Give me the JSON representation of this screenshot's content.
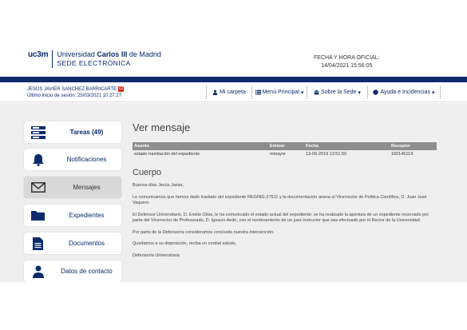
{
  "header": {
    "logo_mark": "uc3m",
    "university_pre": "Universidad ",
    "university_bold": "Carlos III",
    "university_post": " de Madrid",
    "sede": "SEDE ELECTRÓNICA",
    "official_label": "FECHA Y HORA OFICIAL:",
    "official_datetime": "14/04/2021  15:56:05"
  },
  "user": {
    "name": "JESUS JAVIER SANCHEZ BARRICARTE",
    "last_login": "Último inicio de sesión: 25/03/2021 10:27:27",
    "logout_icon": "logout-icon"
  },
  "nav": [
    {
      "label": "Mi carpeta",
      "icon": "person-icon",
      "caret": ""
    },
    {
      "label": "Menú Principal",
      "icon": "list-icon",
      "caret": "▾"
    },
    {
      "label": "Sobre la Sede",
      "icon": "building-icon",
      "caret": "▾"
    },
    {
      "label": "Ayuda e Incidencias",
      "icon": "help-icon",
      "caret": "▾"
    }
  ],
  "sidebar": [
    {
      "label": "Tareas (49)",
      "icon": "tasks-icon",
      "active": false,
      "bold": true
    },
    {
      "label": "Notificaciones",
      "icon": "bell-icon",
      "active": false,
      "bold": false
    },
    {
      "label": "Mensajes",
      "icon": "envelope-icon",
      "active": true,
      "bold": false
    },
    {
      "label": "Expedientes",
      "icon": "folder-icon",
      "active": false,
      "bold": false
    },
    {
      "label": "Documentos",
      "icon": "document-icon",
      "active": false,
      "bold": false
    },
    {
      "label": "Datos de contacto",
      "icon": "user-icon",
      "active": false,
      "bold": false
    }
  ],
  "message": {
    "title": "Ver mensaje",
    "columns": [
      "Asunto",
      "Emisor",
      "Fecha",
      "Receptor"
    ],
    "row": [
      "estado tramitación del expediente",
      "mmayor",
      "13-06-2019 13:51:50",
      "16014611X"
    ],
    "body_title": "Cuerpo",
    "paragraphs": [
      "Buenos días Jesús Javier,",
      "Le comunicamos que hemos dado traslado del expediente REGING-27611 y la documentación anexa al Vicerrector de Política Científica, D. Juan José Vaquero.",
      "El Defensor Universitario, D. Emilio Olías, le ha comunicado el estado actual del expediente: se ha realizado la apertura de un expediente reservado por parte del Vicerrector de Profesorado, D. Ignacio Aedo, con el nombramiento de un juez instructor que sea efectuado por el Rector de la Universidad.",
      "Por parte de la Defensoría consideramos concluida nuestra intervención.",
      "Quedamos a su disposición, reciba un cordial saludo,",
      "Defensoría Universitaria"
    ]
  },
  "colors": {
    "brand_blue": "#0b2b6b",
    "logout_red": "#d9301e",
    "table_header": "#8e8e8e"
  }
}
